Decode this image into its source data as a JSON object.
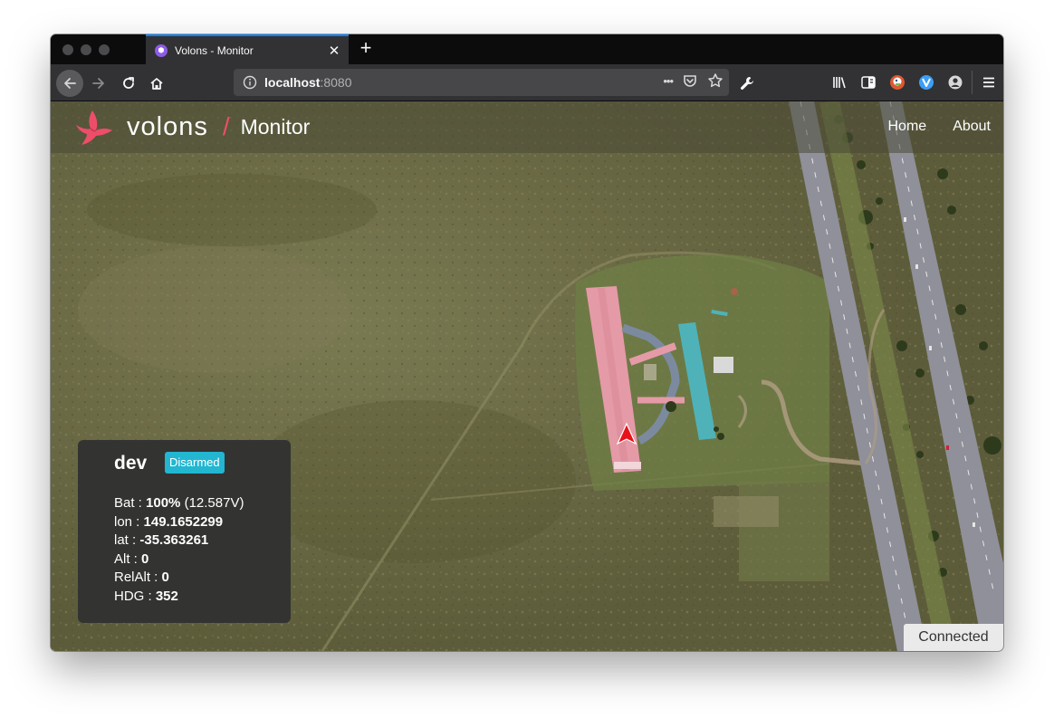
{
  "browser": {
    "tab_title": "Volons - Monitor",
    "tab_close": "✕",
    "new_tab": "+",
    "url_host": "localhost",
    "url_port": ":8080",
    "url_more": "•••",
    "accent_color": "#0a84ff"
  },
  "app": {
    "brand_name": "volons",
    "brand_separator": "/",
    "brand_sub": "Monitor",
    "brand_color": "#ee4d6a",
    "nav": [
      {
        "label": "Home"
      },
      {
        "label": "About"
      }
    ]
  },
  "drone": {
    "name": "dev",
    "armed_status": "Disarmed",
    "bat_label": "Bat : ",
    "bat_percent": "100%",
    "bat_voltage": " (12.587V)",
    "lon_label": "lon : ",
    "lon": "149.1652299",
    "lat_label": "lat : ",
    "lat": "-35.363261",
    "alt_label": "Alt : ",
    "alt": "0",
    "relalt_label": "RelAlt : ",
    "relalt": "0",
    "hdg_label": "HDG : ",
    "hdg": "352"
  },
  "connection": {
    "status": "Connected"
  }
}
